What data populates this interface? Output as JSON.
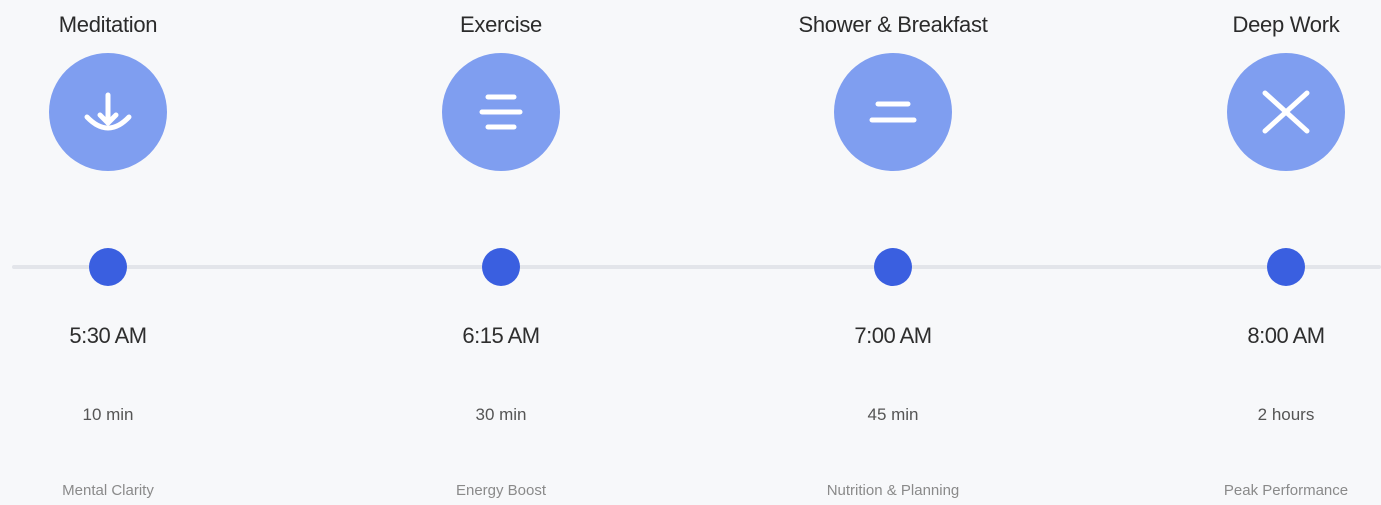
{
  "timeline": {
    "steps": [
      {
        "title": "Meditation",
        "icon": "lotus-icon",
        "time": "5:30 AM",
        "duration": "10 min",
        "benefit": "Mental Clarity"
      },
      {
        "title": "Exercise",
        "icon": "three-lines-icon",
        "time": "6:15 AM",
        "duration": "30 min",
        "benefit": "Energy Boost"
      },
      {
        "title": "Shower & Breakfast",
        "icon": "equals-icon",
        "time": "7:00 AM",
        "duration": "45 min",
        "benefit": "Nutrition & Planning"
      },
      {
        "title": "Deep Work",
        "icon": "cross-icon",
        "time": "8:00 AM",
        "duration": "2 hours",
        "benefit": "Peak Performance"
      }
    ]
  },
  "colors": {
    "background": "#f7f8fa",
    "icon_circle": "#7f9ef0",
    "timeline_dot": "#3a5fe0",
    "timeline_line": "#e3e5ea"
  }
}
